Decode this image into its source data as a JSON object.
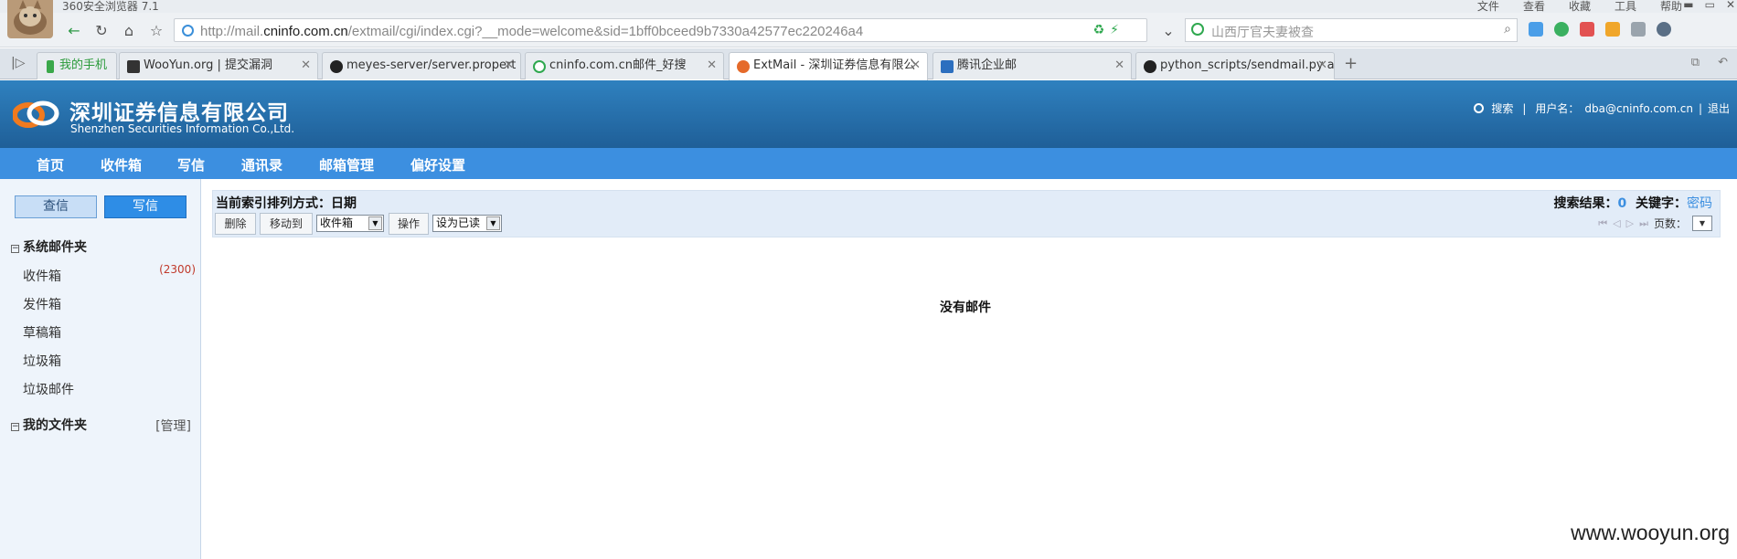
{
  "browser": {
    "title": "360安全浏览器 7.1",
    "menu": [
      "文件",
      "查看",
      "收藏",
      "工具",
      "帮助"
    ],
    "url_prefix": "http://mail.",
    "url_domain": "cninfo.com.cn",
    "url_suffix": "/extmail/cgi/index.cgi?__mode=welcome&sid=1bff0bceed9b7330a42577ec220246a4",
    "search_placeholder": "山西厅官夫妻被查",
    "tabs": [
      {
        "label": "我的手机"
      },
      {
        "label": "WooYun.org | 提交漏洞"
      },
      {
        "label": "meyes-server/server.propert"
      },
      {
        "label": "cninfo.com.cn邮件_好搜"
      },
      {
        "label": "ExtMail - 深圳证券信息有限公"
      },
      {
        "label": "腾讯企业邮"
      },
      {
        "label": "python_scripts/sendmail.py a"
      }
    ]
  },
  "header": {
    "company_cn": "深圳证券信息有限公司",
    "company_en": "Shenzhen Securities Information Co.,Ltd.",
    "search_label": "搜索",
    "user_label": "用户名：",
    "user_email": "dba@cninfo.com.cn",
    "logout_label": "退出"
  },
  "nav": [
    "首页",
    "收件箱",
    "写信",
    "通讯录",
    "邮箱管理",
    "偏好设置"
  ],
  "sidebar": {
    "check_mail": "查信",
    "compose": "写信",
    "system_folders_title": "系统邮件夹",
    "system_folders": [
      {
        "label": "收件箱",
        "count": "(2300)"
      },
      {
        "label": "发件箱",
        "count": ""
      },
      {
        "label": "草稿箱",
        "count": ""
      },
      {
        "label": "垃圾箱",
        "count": ""
      },
      {
        "label": "垃圾邮件",
        "count": ""
      }
    ],
    "my_folders_title": "我的文件夹",
    "manage_label": "[管理]"
  },
  "toolbar": {
    "sort_label": "当前索引排列方式：日期",
    "delete": "删除",
    "move_to": "移动到",
    "move_target": "收件箱",
    "action": "操作",
    "mark_as": "设为已读",
    "search_result_label": "搜索结果：",
    "search_result_count": "0",
    "keyword_label": "关键字：",
    "keyword": "密码",
    "pages_label": "页数："
  },
  "main": {
    "empty_message": "没有邮件"
  },
  "watermark": "www.wooyun.org"
}
